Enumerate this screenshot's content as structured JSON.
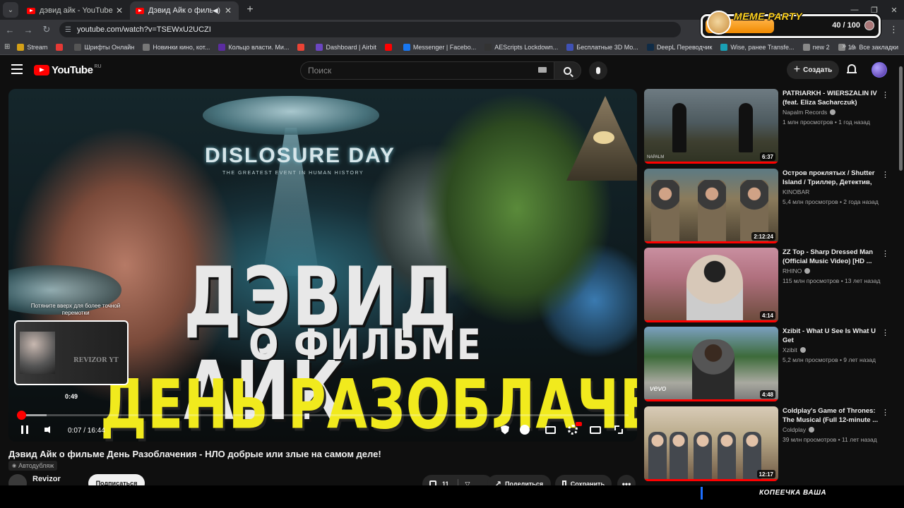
{
  "browser": {
    "tabs": [
      {
        "title": "дэвид айк - YouTube",
        "active": false
      },
      {
        "title": "Дэвид Айк о фильме День Разоблачения",
        "active": true
      }
    ],
    "url": "youtube.com/watch?v=TSEWxU2UCZI",
    "bookmarks": [
      {
        "label": "Stream",
        "color": "#d4a017"
      },
      {
        "label": "",
        "color": "#e53935"
      },
      {
        "label": "Шрифты Онлайн",
        "color": "#555555"
      },
      {
        "label": "Новинки кино, кот...",
        "color": "#777777"
      },
      {
        "label": "Кольцо власти. Ми...",
        "color": "#5b2ca0"
      },
      {
        "label": "",
        "color": "#ea4335"
      },
      {
        "label": "Dashboard | Airbit",
        "color": "#6b46c1"
      },
      {
        "label": "",
        "color": "#ff0000"
      },
      {
        "label": "Messenger | Facebo...",
        "color": "#1877f2"
      },
      {
        "label": "AEScripts Lockdown...",
        "color": "#333333"
      },
      {
        "label": "Бесплатные 3D Мо...",
        "color": "#3f51b5"
      },
      {
        "label": "DeepL Переводчик",
        "color": "#0f2b46"
      },
      {
        "label": "Wise, ранее Transfe...",
        "color": "#19a0b5"
      },
      {
        "label": "new 2",
        "color": "#888888"
      },
      {
        "label": "19",
        "color": "#888888"
      }
    ],
    "bookmarks_more": "»",
    "all_bookmarks": "Все закладки"
  },
  "meme_party": {
    "title": "MEME PARTY",
    "count": "40 / 100",
    "progress": 0.4
  },
  "youtube": {
    "logo": "YouTube",
    "region": "RU",
    "search_placeholder": "Поиск",
    "create_label": "Создать"
  },
  "player": {
    "thumbnail_texts": {
      "disclosure": "DISLOSURE DAY",
      "disclosure_sub": "THE GREATEST EVENT IN HUMAN HISTORY",
      "line1": "ДЭВИД АЙК",
      "line2": "О ФИЛЬМЕ",
      "line3": "ДЕНЬ РАЗОБЛАЧЕНИЯ"
    },
    "scrub_tip": "Потяните вверх для более точной перемотки",
    "preview_brand": "REVIZOR YT",
    "preview_time": "0:49",
    "time": "0:07 / 16:44",
    "played_fraction": 0.007,
    "hover_fraction": 0.049
  },
  "video": {
    "title": "Дэвид Айк о фильме День Разоблачения - НЛО добрые или злые на самом деле!",
    "autodub": "Автодубляж",
    "channel": "Revizor",
    "subscribe_label": "Подписаться",
    "likes": "11",
    "share_label": "Поделиться",
    "save_label": "Сохранить"
  },
  "recommendations": [
    {
      "title": "PATRIARKH - WIERSZALIN IV (feat. Eliza Sacharczuk) (Offici...",
      "channel": "Napalm Records",
      "verified": true,
      "stats": "1 млн просмотров • 1 год назад",
      "duration": "6:37",
      "thumb_text": "NAPALM"
    },
    {
      "title": "Остров проклятых / Shutter Island / Триллер, Детектив, ...",
      "channel": "KINOBAR",
      "verified": false,
      "stats": "5,4 млн просмотров • 2 года назад",
      "duration": "2:12:24",
      "thumb_text": ""
    },
    {
      "title": "ZZ Top - Sharp Dressed Man (Official Music Video) [HD ...",
      "channel": "RHINO",
      "verified": true,
      "stats": "115 млн просмотров • 13 лет назад",
      "duration": "4:14",
      "thumb_text": ""
    },
    {
      "title": "Xzibit - What U See Is What U Get",
      "channel": "Xzibit",
      "verified": true,
      "stats": "5,2 млн просмотров • 9 лет назад",
      "duration": "4:48",
      "thumb_text": "vevo"
    },
    {
      "title": "Coldplay's Game of Thrones: The Musical (Full 12-minute ...",
      "channel": "Coldplay",
      "verified": true,
      "stats": "39 млн просмотров • 11 лет назад",
      "duration": "12:17",
      "thumb_text": ""
    }
  ],
  "ticker": {
    "text": "КОПЕЕЧКА ВАША"
  }
}
